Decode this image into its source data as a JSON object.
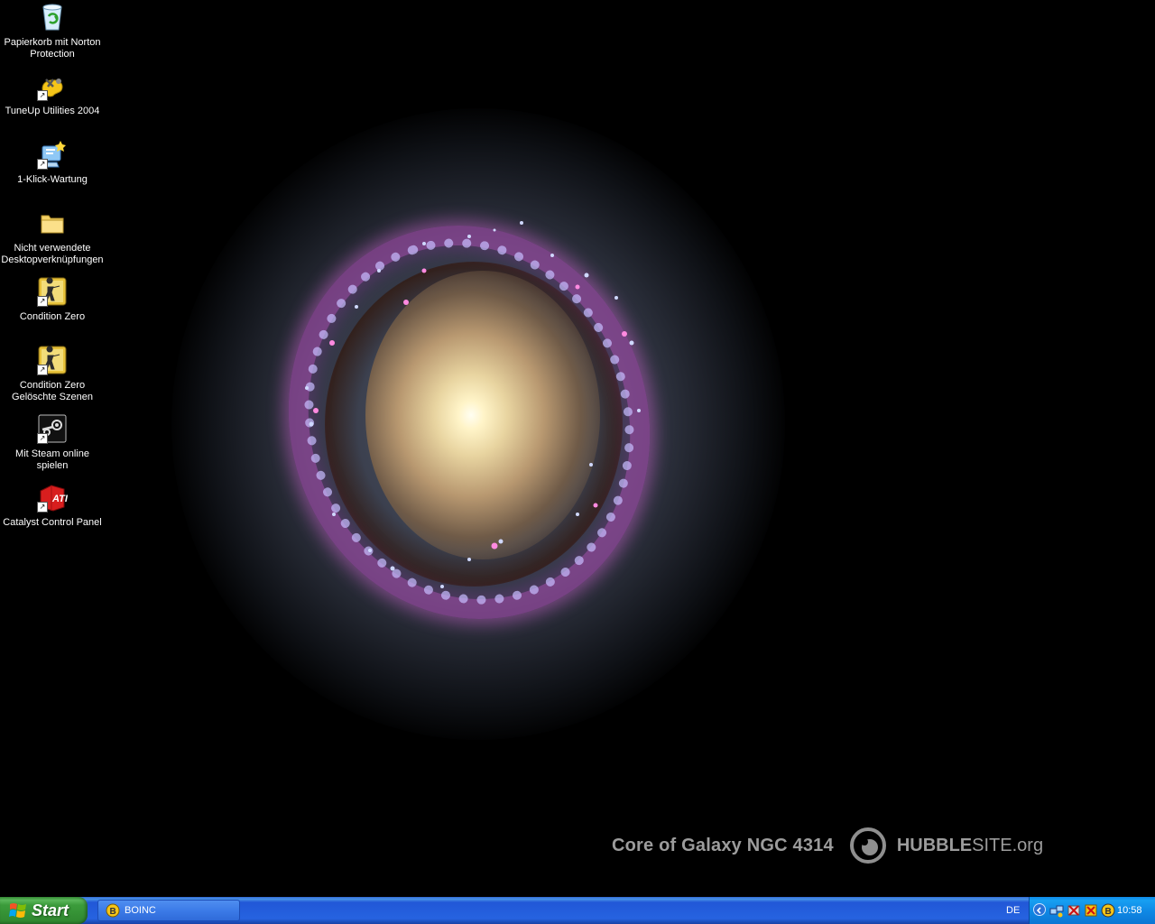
{
  "wallpaper": {
    "caption": "Core of Galaxy NGC 4314",
    "brand_bold": "HUBBLE",
    "brand_light": "SITE.org"
  },
  "desktop_icons": [
    {
      "id": "recycle-bin",
      "label_lines": [
        "Papierkorb mit Norton",
        "Protection"
      ],
      "icon": "recycle-bin-icon"
    },
    {
      "id": "tuneup",
      "label_lines": [
        "TuneUp Utilities 2004"
      ],
      "icon": "tuneup-icon"
    },
    {
      "id": "one-click",
      "label_lines": [
        "1-Klick-Wartung"
      ],
      "icon": "maintenance-icon"
    },
    {
      "id": "unused-shortcuts",
      "label_lines": [
        "Nicht verwendete",
        "Desktopverknüpfungen"
      ],
      "icon": "folder-icon"
    },
    {
      "id": "condition-zero",
      "label_lines": [
        "Condition Zero"
      ],
      "icon": "condition-zero-icon"
    },
    {
      "id": "condition-zero-deleted",
      "label_lines": [
        "Condition Zero",
        "Gelöschte Szenen"
      ],
      "icon": "condition-zero-icon"
    },
    {
      "id": "steam",
      "label_lines": [
        "Mit Steam online",
        "spielen"
      ],
      "icon": "steam-icon"
    },
    {
      "id": "catalyst",
      "label_lines": [
        "Catalyst Control Panel"
      ],
      "icon": "ati-icon"
    }
  ],
  "taskbar": {
    "start_label": "Start",
    "tasks": [
      {
        "label": "BOINC",
        "icon": "boinc-icon"
      }
    ],
    "language": "DE",
    "clock": "10:58",
    "tray_icons": [
      "network-icon",
      "norton-icon",
      "antivirus-icon",
      "boinc-icon"
    ]
  },
  "colors": {
    "taskbar_blue": "#2663e0",
    "start_green": "#3b9c3b",
    "tray_blue": "#0f8ae6"
  }
}
